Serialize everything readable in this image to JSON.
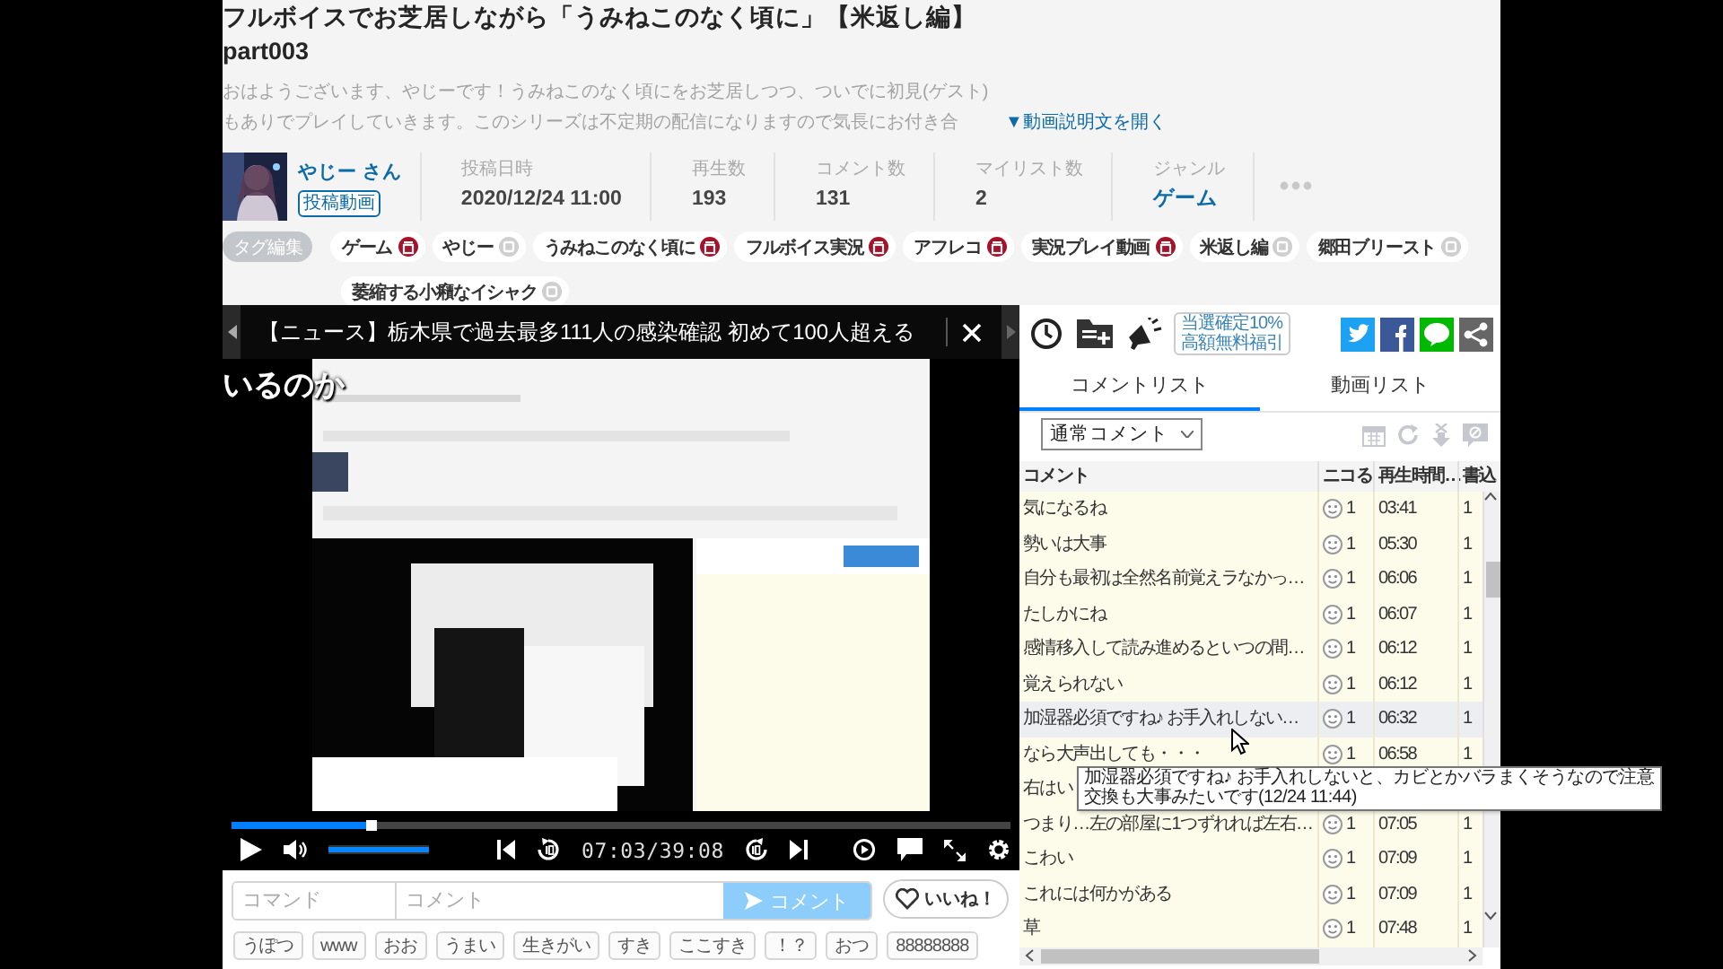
{
  "video": {
    "title": "フルボイスでお芝居しながら「うみねこのなく頃に」【米返し編】part003",
    "description": "おはようございます、やじーです！うみねこのなく頃にをお芝居しつつ、ついでに初見(ゲスト)もありでプレイしていきます。このシリーズは不定期の配信になりますので気長にお付き合",
    "description_link": "▼動画説明文を開く"
  },
  "owner": {
    "name": "やじー さん",
    "badge": "投稿動画"
  },
  "stats": [
    {
      "label": "投稿日時",
      "value": "2020/12/24 11:00",
      "kind": "text"
    },
    {
      "label": "再生数",
      "value": "193",
      "kind": "text"
    },
    {
      "label": "コメント数",
      "value": "131",
      "kind": "text"
    },
    {
      "label": "マイリスト数",
      "value": "2",
      "kind": "text"
    },
    {
      "label": "ジャンル",
      "value": "ゲーム",
      "kind": "link"
    }
  ],
  "tag_edit": "タグ編集",
  "tags": [
    {
      "label": "ゲーム",
      "dictionary": true
    },
    {
      "label": "やじー",
      "dictionary": false
    },
    {
      "label": "うみねこのなく頃に",
      "dictionary": true
    },
    {
      "label": "フルボイス実況",
      "dictionary": true
    },
    {
      "label": "アフレコ",
      "dictionary": true
    },
    {
      "label": "実況プレイ動画",
      "dictionary": true
    },
    {
      "label": "米返し編",
      "dictionary": false
    },
    {
      "label": "郷田ブリースト",
      "dictionary": false
    },
    {
      "label": "萎縮する小癪なイシャク",
      "dictionary": false
    }
  ],
  "player": {
    "news": "【ニュース】栃木県で過去最多111人の感染確認 初めて100人超える",
    "overlay_comment": "いるのか",
    "time": "07:03/39:08",
    "seek": {
      "level": 0.18
    },
    "volume": {
      "level": 1
    }
  },
  "comment_form": {
    "command_placeholder": "コマンド",
    "comment_placeholder": "コメント",
    "submit": "コメント",
    "like": "いいね！"
  },
  "quick_comments": [
    "うぽつ",
    "www",
    "おお",
    "うまい",
    "生きがい",
    "すき",
    "ここすき",
    "！？",
    "おつ",
    "88888888"
  ],
  "side": {
    "ad": [
      "当選確定10%",
      "高額無料福引"
    ],
    "tabs": [
      {
        "label": "コメントリスト",
        "selected": true
      },
      {
        "label": "動画リスト",
        "selected": false
      }
    ],
    "filter": "通常コメント",
    "columns": [
      "コメント",
      "ニコる",
      "再生時間…",
      "書込"
    ],
    "rows": [
      {
        "comment": "気になるね",
        "nicoru": "1",
        "time": "03:41",
        "column_4": "1",
        "highlighted": false
      },
      {
        "comment": "勢いは大事",
        "nicoru": "1",
        "time": "05:30",
        "column_4": "1",
        "highlighted": false
      },
      {
        "comment": "自分も最初は全然名前覚えラなかっ…",
        "nicoru": "1",
        "time": "06:06",
        "column_4": "1",
        "highlighted": false
      },
      {
        "comment": "たしかにね",
        "nicoru": "1",
        "time": "06:07",
        "column_4": "1",
        "highlighted": false
      },
      {
        "comment": "感情移入して読み進めるといつの間…",
        "nicoru": "1",
        "time": "06:12",
        "column_4": "1",
        "highlighted": false
      },
      {
        "comment": "覚えられない",
        "nicoru": "1",
        "time": "06:12",
        "column_4": "1",
        "highlighted": false
      },
      {
        "comment": "加湿器必須ですね♪ お手入れしない…",
        "nicoru": "1",
        "time": "06:32",
        "column_4": "1",
        "highlighted": true
      },
      {
        "comment": "なら大声出しても・・・",
        "nicoru": "1",
        "time": "06:58",
        "column_4": "1",
        "highlighted": false
      },
      {
        "comment": "右はい",
        "highlighted": false
      },
      {
        "comment": "つまり…左の部屋に1つずれれば左右…",
        "nicoru": "1",
        "time": "07:05",
        "column_4": "1",
        "highlighted": false
      },
      {
        "comment": "こわい",
        "nicoru": "1",
        "time": "07:09",
        "column_4": "1",
        "highlighted": false
      },
      {
        "comment": "これには何かがある",
        "nicoru": "1",
        "time": "07:09",
        "column_4": "1",
        "highlighted": false
      },
      {
        "comment": "草",
        "nicoru": "1",
        "time": "07:48",
        "column_4": "1",
        "highlighted": false
      }
    ],
    "tooltip_lines": [
      "加湿器必須ですね♪ お手入れしないと、カビとかバラまくそうなので注意",
      "交換も大事みたいです(12/24 11:44)"
    ]
  }
}
